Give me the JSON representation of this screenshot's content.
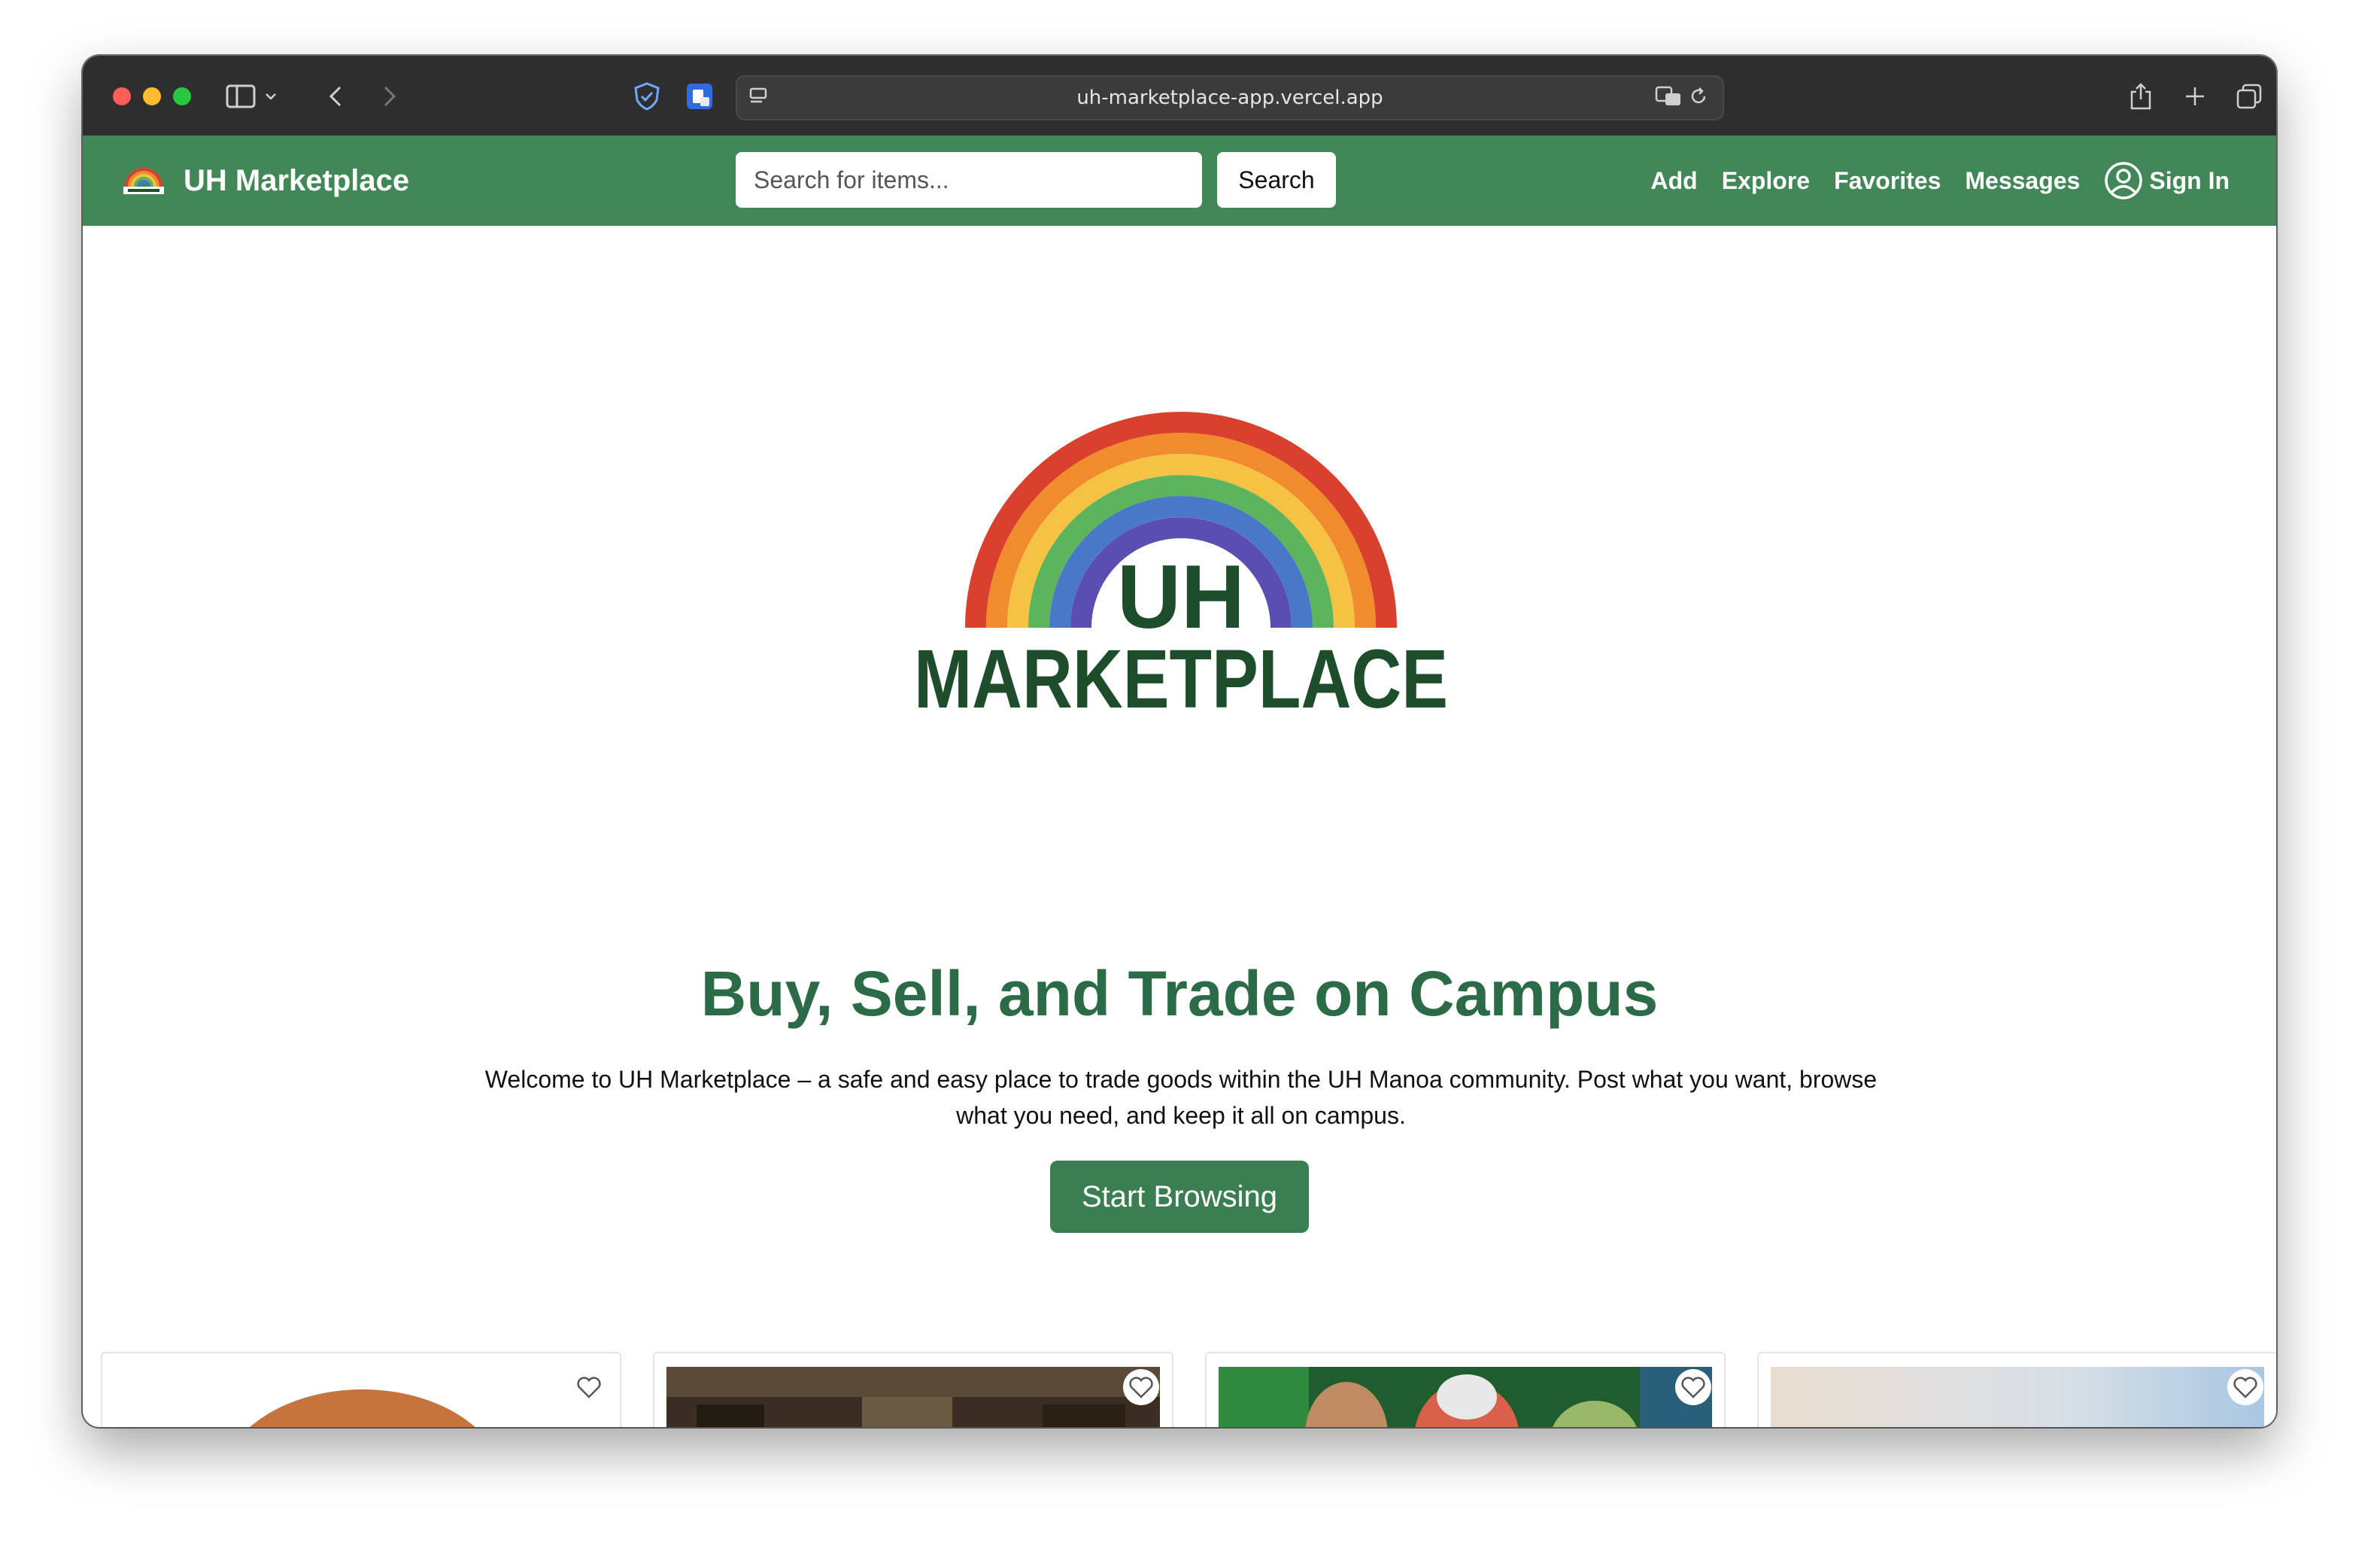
{
  "browser": {
    "url": "uh-marketplace-app.vercel.app"
  },
  "navbar": {
    "brand": "UH Marketplace",
    "search_placeholder": "Search for items...",
    "search_button": "Search",
    "links": [
      "Add",
      "Explore",
      "Favorites",
      "Messages"
    ],
    "sign_in": "Sign In"
  },
  "hero": {
    "logo_line1": "UH",
    "logo_line2": "MARKETPLACE",
    "title": "Buy, Sell, and Trade on Campus",
    "description": "Welcome to UH Marketplace – a safe and easy place to trade goods within the UH Manoa community. Post what you want, browse what you need, and keep it all on campus.",
    "cta": "Start Browsing"
  },
  "colors": {
    "brand_green": "#428757",
    "title_green": "#2b6b47",
    "logo_text": "#1e4d2b"
  },
  "cards": [
    {
      "image": "basketball"
    },
    {
      "image": "interior-photo"
    },
    {
      "image": "star-wars-poster"
    },
    {
      "image": "sky-photo"
    }
  ]
}
